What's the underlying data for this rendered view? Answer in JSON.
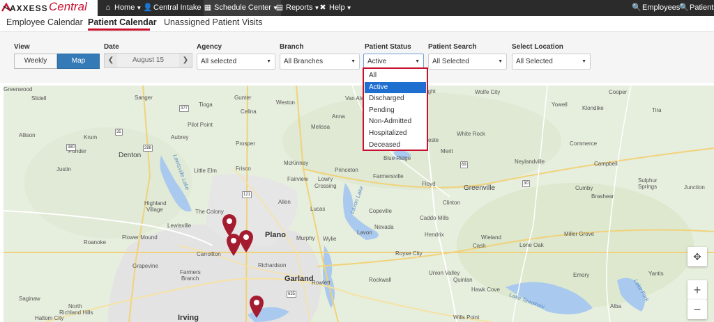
{
  "nav": {
    "logo_axxess": "AXXESS",
    "logo_central": "Central",
    "items": [
      {
        "icon": "home-icon",
        "label": "Home"
      },
      {
        "icon": "user-plus-icon",
        "label": "Central Intake"
      },
      {
        "icon": "calendar-icon",
        "label": "Schedule Center"
      },
      {
        "icon": "reports-icon",
        "label": "Reports"
      },
      {
        "icon": "help-icon",
        "label": "Help"
      }
    ],
    "right": [
      {
        "icon": "search-icon",
        "label": "Employees"
      },
      {
        "icon": "search-icon",
        "label": "Patients"
      }
    ]
  },
  "tabs": [
    "Employee Calendar",
    "Patient Calendar",
    "Unassigned Patient Visits"
  ],
  "filters": {
    "view_label": "View",
    "view_options": [
      "Weekly",
      "Map"
    ],
    "date_label": "Date",
    "date_value": "August 15",
    "agency_label": "Agency",
    "agency_value": "All selected",
    "branch_label": "Branch",
    "branch_value": "All Branches",
    "status_label": "Patient Status",
    "status_value": "Active",
    "search_label": "Patient Search",
    "search_value": "All Selected",
    "location_label": "Select Location",
    "location_value": "All Selected"
  },
  "status_options": [
    "All",
    "Active",
    "Discharged",
    "Pending",
    "Non-Admitted",
    "Hospitalized",
    "Deceased"
  ],
  "accent_color": "#c8102e",
  "map": {
    "cities": {
      "greenwood": "Greenwood",
      "slidell": "Slidell",
      "sanger": "Sanger",
      "weston": "Weston",
      "celina": "Celina",
      "gunter": "Gunter",
      "tioga": "Tioga",
      "pilotpoint": "Pilot Point",
      "melissa": "Melissa",
      "anna": "Anna",
      "vanalstyne": "Van Alstyne",
      "whitewright": "Whitewright",
      "wolfecity": "Wolfe City",
      "cooper": "Cooper",
      "klondike": "Klondike",
      "tira": "Tira",
      "yowell": "Yowell",
      "whiterock": "White Rock",
      "allison": "Allison",
      "krum": "Krum",
      "aubrey": "Aubrey",
      "prosper": "Prosper",
      "ponder": "Ponder",
      "denton": "Denton",
      "littleelm": "Little Elm",
      "frisco": "Frisco",
      "mckinney": "McKinney",
      "princeton": "Princeton",
      "blueridge": "Blue Ridge",
      "celeste": "Celeste",
      "merit": "Merit",
      "commerce": "Commerce",
      "neylandville": "Neylandville",
      "campbell": "Campbell",
      "greenville": "Greenville",
      "floyd": "Floyd",
      "farmersville": "Farmersville",
      "justin": "Justin",
      "lowry": "Lowry",
      "crossing": "Crossing",
      "fairview": "Fairview",
      "highland": "Highland",
      "village": "Village",
      "thecolony": "The Colony",
      "allen": "Allen",
      "lucas": "Lucas",
      "copeville": "Copeville",
      "clinton": "Clinton",
      "caddomills": "Caddo Mills",
      "cumby": "Cumby",
      "brashear": "Brashear",
      "sulphur": "Sulphur",
      "springs": "Springs",
      "junction": "Junction",
      "lewisville": "Lewisville",
      "nevada": "Nevada",
      "lavon": "Lavon",
      "plano": "Plano",
      "hendrix": "Hendrix",
      "wieland": "Wieland",
      "lonedak": "Lone Oak",
      "millergrove": "Miller Grove",
      "roanoke": "Roanoke",
      "flowermound": "Flower Mound",
      "carrollton": "Carrollton",
      "murphy": "Murphy",
      "wylie": "Wylie",
      "cash": "Cash",
      "roysecity": "Royse City",
      "richardson": "Richardson",
      "grapevine": "Grapevine",
      "farmers": "Farmers",
      "branch": "Branch",
      "rockwall": "Rockwall",
      "unionvalley": "Union Valley",
      "quinlan": "Quinlan",
      "laketawakoni": "Lake Tawakoni",
      "emory": "Emory",
      "yantis": "Yantis",
      "garland": "Garland",
      "rowlett": "Rowlett",
      "hawkcove": "Hawk Cove",
      "saginaw": "Saginaw",
      "northrichland": "North",
      "richlandhills": "Richland Hills",
      "irving": "Irving",
      "willspoint": "Wills Point",
      "alba": "Alba",
      "haltom": "Haltom City"
    },
    "water": {
      "lewisvillelake": "Lewisville Lake",
      "lavonlake": "Lavon Lake",
      "laketawakoni": "Lake Tawakoni",
      "lakefork": "Lake Fork"
    },
    "pin_color": "#a51c30"
  }
}
